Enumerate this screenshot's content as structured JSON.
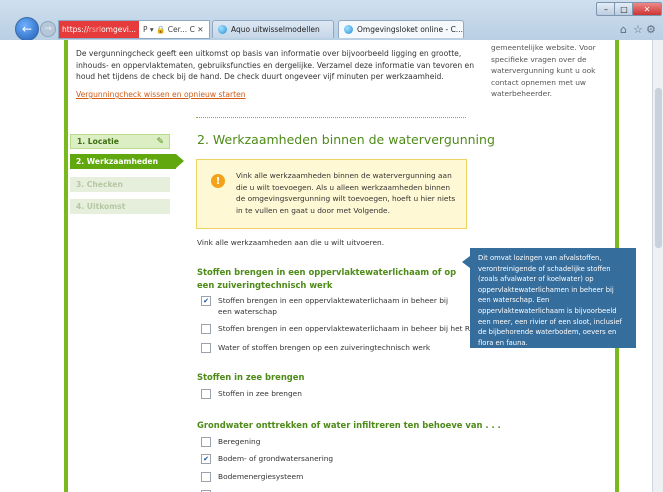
{
  "browser": {
    "address_secure": "https://",
    "address_blur": "rsrl",
    "address_domain": "omgevi...",
    "address_tail": "P ▾ 🔒 Cer... C ✕",
    "tabs": [
      {
        "label": "Aquo uitwisselmodellen"
      },
      {
        "label": "Omgevingsloket online - C...",
        "close": "✕"
      }
    ],
    "window_close": "✕"
  },
  "page": {
    "intro": "De vergunningcheck geeft een uitkomst op basis van informatie over bijvoorbeeld ligging en grootte, inhouds- en oppervlaktematen, gebruiksfuncties en dergelijke. Verzamel deze informatie van tevoren en houd het tijdens de check bij de hand. De check duurt ongeveer vijf minuten per werkzaamheid.",
    "reset_link": "Vergunningcheck wissen en opnieuw starten",
    "sidebar_text": "gemeentelijke website. Voor specifieke vragen over de watervergunning kunt u ook contact opnemen met uw waterbeheerder.",
    "steps": [
      {
        "label": "1. Locatie"
      },
      {
        "label": "2. Werkzaamheden"
      },
      {
        "label": "3. Checken"
      },
      {
        "label": "4. Uitkomst"
      }
    ],
    "heading": "2. Werkzaamheden binnen de watervergunning",
    "note_icon": "!",
    "note_text": "Vink alle werkzaamheden binnen de watervergunning aan die u wilt toevoegen. Als u alleen werkzaamheden binnen de omgevingsvergunning wilt toevoegen, hoeft u hier niets in te vullen en gaat u door met Volgende.",
    "instruction": "Vink alle werkzaamheden aan die u wilt uitvoeren.",
    "sections": [
      {
        "title": "Stoffen brengen in een oppervlaktewaterlichaam of op een zuiveringtechnisch werk",
        "items": [
          {
            "label": "Stoffen brengen in een oppervlaktewaterlichaam in beheer bij een waterschap",
            "checked": true
          },
          {
            "label": "Stoffen brengen in een oppervlaktewaterlichaam in beheer bij het Rijk",
            "checked": false
          },
          {
            "label": "Water of stoffen brengen op een zuiveringtechnisch werk",
            "checked": false
          }
        ]
      },
      {
        "title": "Stoffen in zee brengen",
        "items": [
          {
            "label": "Stoffen in zee brengen",
            "checked": false
          }
        ]
      },
      {
        "title": "Grondwater onttrekken of water infiltreren ten behoeve van . . .",
        "items": [
          {
            "label": "Beregening",
            "checked": false
          },
          {
            "label": "Bodem- of grondwatersanering",
            "checked": true
          },
          {
            "label": "Bodemenergiesysteem",
            "checked": false
          }
        ]
      }
    ],
    "tooltip": "Dit omvat lozingen van afvalstoffen, verontreinigende of schadelijke stoffen (zoals afvalwater of koelwater) op oppervlaktewaterlichamen in beheer bij een waterschap. Een oppervlaktewaterlichaam is bijvoorbeeld een meer, een rivier of een sloot, inclusief de bijbehorende waterbodem, oevers en flora en fauna."
  }
}
